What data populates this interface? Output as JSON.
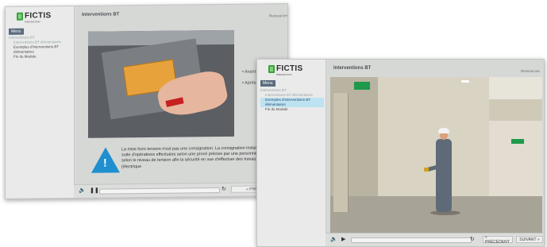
{
  "window1": {
    "logo": {
      "text": "FICTIS",
      "sub": "PREVENTION"
    },
    "menu_label": "Menu",
    "menu_items": [
      "Interventions BT",
      "Interventions BT élémentaires",
      "Exemples d'Interventions BT élémentaires",
      "Fin du Module"
    ],
    "title": "Interventions BT",
    "resources_label": "Ressources",
    "bullets": [
      "Avant",
      "Après"
    ],
    "warning_text": "La mise hors tension n'est pas une consignation. La consignation installation est une suite d'opérations effectuées selon une procé précise par une personne habilitée selon le niveau de tension afin la sécurité en vue d'effectuer des travaux hors tension (électrique",
    "prev_label": "« PRÉCÉDEN",
    "icons": [
      "volume-icon",
      "pause-icon",
      "reload-icon",
      "warning-icon"
    ]
  },
  "window2": {
    "logo": {
      "text": "FICTIS",
      "sub": "PREVENTION"
    },
    "menu_label": "Menu",
    "menu_items": [
      "Interventions BT",
      "Interventions BT élémentaires",
      "Exemples d'Interventions BT élémentaires",
      "Fin du Module"
    ],
    "title": "Interventions BT",
    "resources_label": "Ressources",
    "prev_label": "« PRÉCÉDENT",
    "next_label": "SUIVANT »",
    "icons": [
      "volume-icon",
      "play-icon",
      "reload-icon"
    ]
  },
  "colors": {
    "accent": "#1f8fcf",
    "menu_active": "#bde3f2",
    "logo_green": "#3aa33a"
  }
}
